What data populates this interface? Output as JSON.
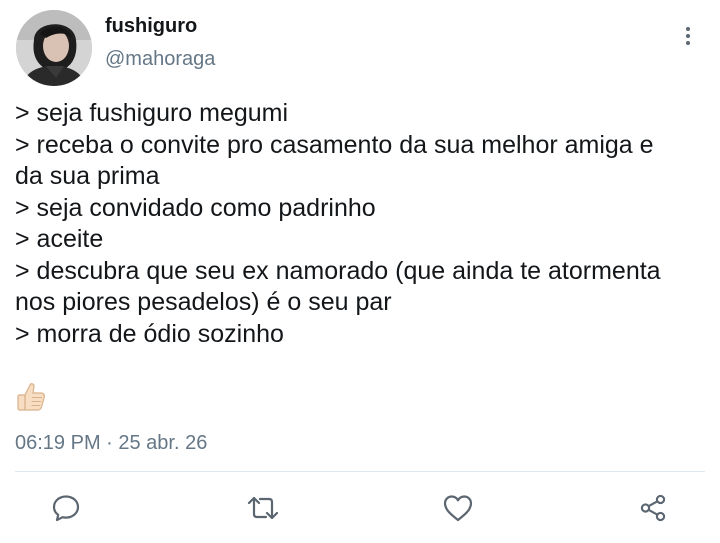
{
  "author": {
    "display_name": "fushiguro",
    "handle": "@mahoraga",
    "avatar_icon": "profile-photo"
  },
  "menu": {
    "icon": "more-vertical-icon"
  },
  "tweet": {
    "lines": [
      "> seja fushiguro megumi",
      "> receba o convite pro casamento da sua melhor amiga e",
      "da sua prima",
      "> seja convidado como padrinho",
      "> aceite",
      "> descubra que seu ex namorado (que ainda te atormenta",
      "nos piores pesadelos) é o seu par",
      "> morra de ódio sozinho"
    ],
    "emoji": "👍🏻",
    "timestamp": "06:19 PM · 25 abr. 26"
  },
  "actions": [
    {
      "name": "reply",
      "icon": "reply-icon"
    },
    {
      "name": "retweet",
      "icon": "retweet-icon"
    },
    {
      "name": "like",
      "icon": "heart-icon"
    },
    {
      "name": "share",
      "icon": "share-icon"
    }
  ],
  "colors": {
    "text": "#14171a",
    "secondary": "#657786",
    "icon": "#5b6670",
    "divider": "#e1e8ed"
  }
}
